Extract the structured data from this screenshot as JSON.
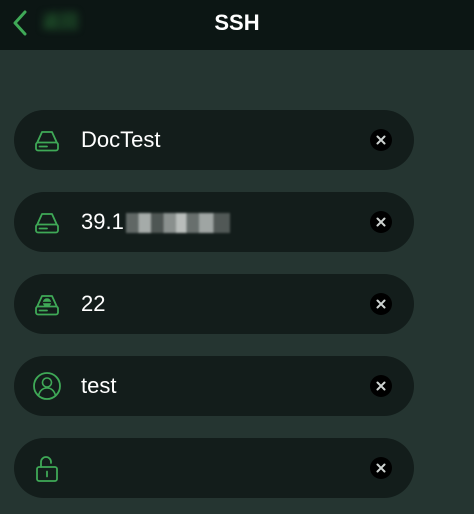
{
  "nav": {
    "title": "SSH",
    "back_label": "返回"
  },
  "fields": [
    {
      "name": "name-field",
      "icon": "drive-icon",
      "value": "DocTest",
      "clear_icon": "clear-icon"
    },
    {
      "name": "host-field",
      "icon": "drive-icon",
      "value": "39.1",
      "masked_suffix": true,
      "clear_icon": "clear-icon"
    },
    {
      "name": "port-field",
      "icon": "drive-port-icon",
      "value": "22",
      "clear_icon": "clear-icon"
    },
    {
      "name": "username-field",
      "icon": "user-icon",
      "value": "test",
      "clear_icon": "clear-icon"
    },
    {
      "name": "password-field",
      "icon": "unlock-icon",
      "value": "",
      "clear_icon": "clear-icon"
    }
  ],
  "colors": {
    "background": "#253531",
    "nav_background": "#0c1614",
    "field_background": "#131d1b",
    "accent_green": "#3fa957",
    "text": "#ffffff"
  }
}
